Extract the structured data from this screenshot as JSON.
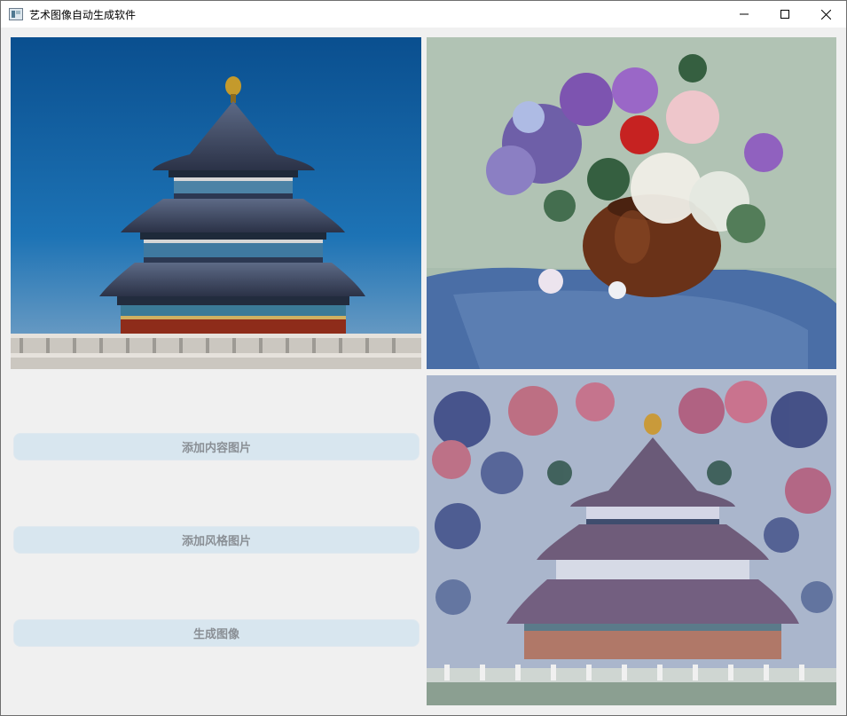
{
  "window": {
    "title": "艺术图像自动生成软件",
    "icons": {
      "minimize": "minimize-icon",
      "maximize": "maximize-icon",
      "close": "close-icon"
    }
  },
  "images": {
    "content": "temple-of-heaven-photo",
    "style": "flower-vase-painting",
    "result": "stylized-temple-output"
  },
  "buttons": {
    "add_content": "添加内容图片",
    "add_style": "添加风格图片",
    "generate": "生成图像"
  },
  "colors": {
    "button_bg": "#d8e6ef",
    "button_text": "#8a8f95",
    "window_bg": "#f0f0f0"
  }
}
